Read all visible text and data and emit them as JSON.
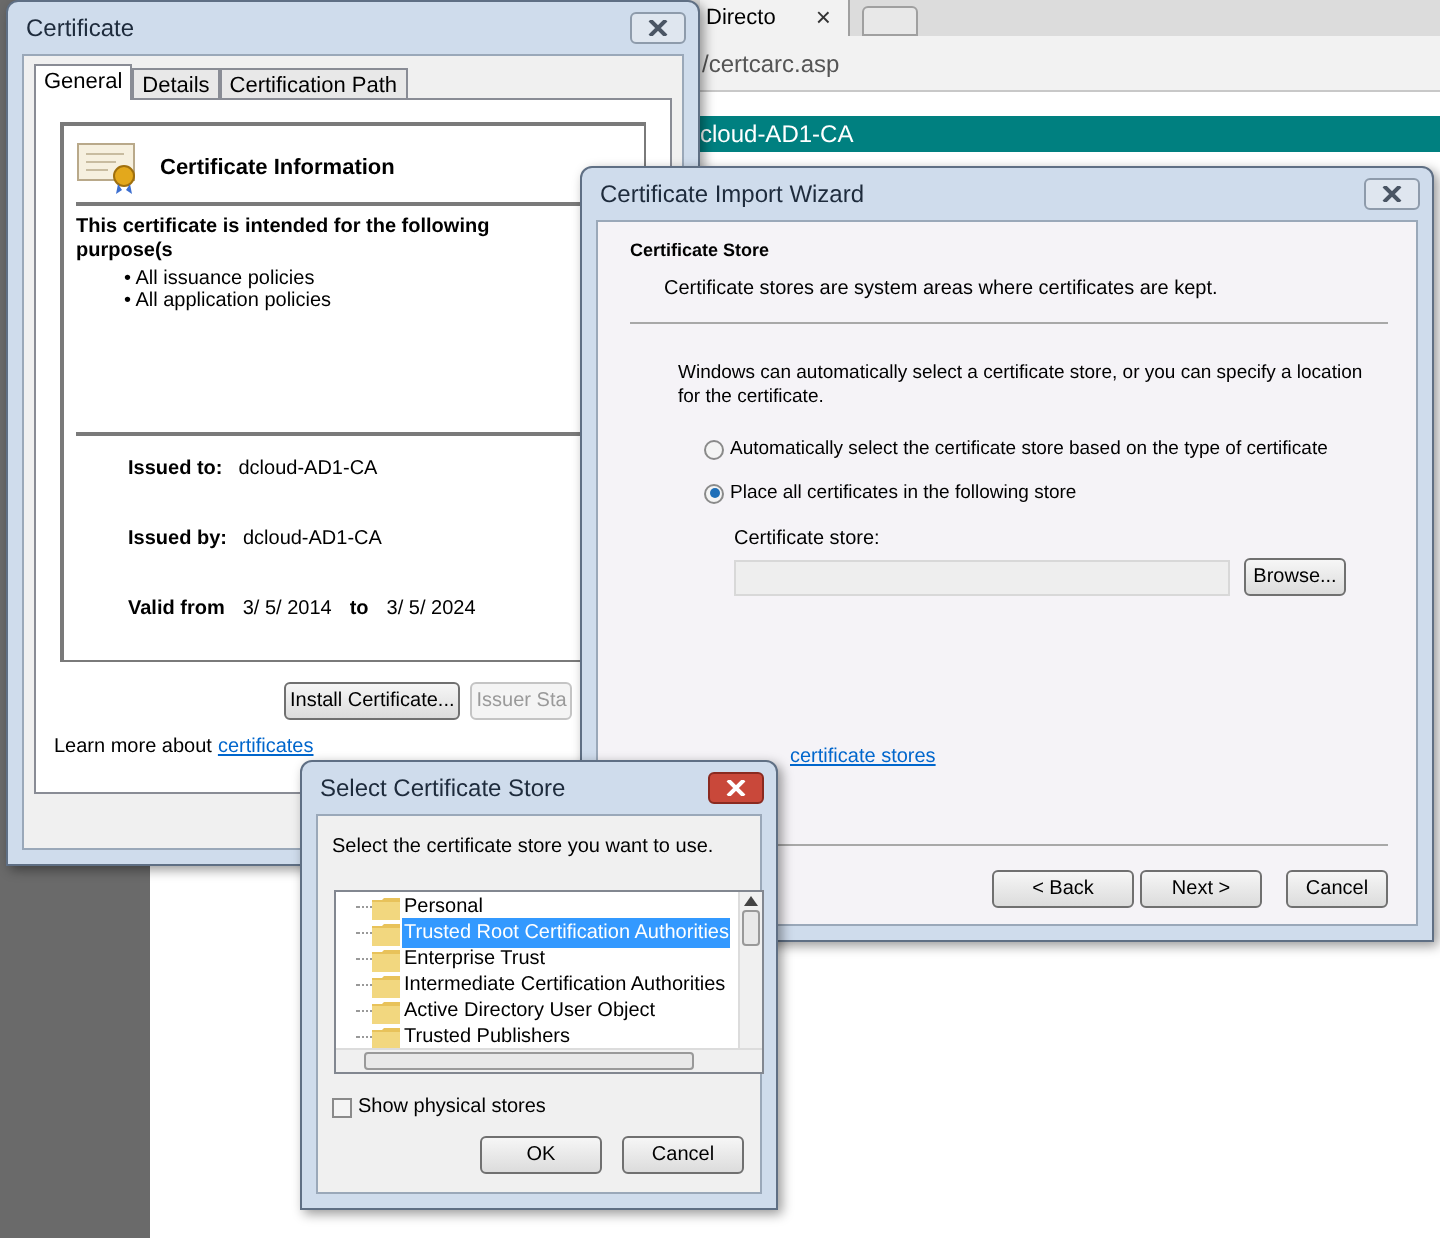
{
  "browser": {
    "tab_title": "Directo",
    "tab_close": "×",
    "address": "/certcarc.asp",
    "banner": "cloud-AD1-CA"
  },
  "certificate_window": {
    "title": "Certificate",
    "tabs": [
      {
        "label": "General",
        "selected": true
      },
      {
        "label": "Details",
        "selected": false
      },
      {
        "label": "Certification Path",
        "selected": false
      }
    ],
    "info_title": "Certificate Information",
    "purpose_heading": "This certificate is intended for the following purpose(s",
    "purposes": [
      "• All issuance policies",
      "• All application policies"
    ],
    "fields": [
      {
        "label": "Issued to:",
        "value": "dcloud-AD1-CA"
      },
      {
        "label": "Issued by:",
        "value": "dcloud-AD1-CA"
      }
    ],
    "validity": {
      "label": "Valid from",
      "from": "3/ 5/ 2014",
      "to_label": "to",
      "to": "3/ 5/ 2024"
    },
    "buttons": [
      {
        "label": "Install Certificate...",
        "disabled": false
      },
      {
        "label": "Issuer Sta",
        "disabled": true
      }
    ],
    "learn_more": {
      "text": "Learn more about",
      "link": "certificates"
    }
  },
  "import_wizard": {
    "title": "Certificate Import Wizard",
    "heading": "Certificate Store",
    "description": "Certificate stores are system areas where certificates are kept.",
    "intro": "Windows can automatically select a certificate store, or you can specify a location for the certificate.",
    "options": [
      {
        "label": "Automatically select the certificate store based on the type of certificate",
        "selected": false
      },
      {
        "label": "Place all certificates in the following store",
        "selected": true
      }
    ],
    "store_label": "Certificate store:",
    "browse": "Browse...",
    "learn_more_link": "certificate stores",
    "buttons": [
      "< Back",
      "Next >",
      "Cancel"
    ]
  },
  "select_store": {
    "title": "Select Certificate Store",
    "prompt": "Select the certificate store you want to use.",
    "stores": [
      {
        "label": "Personal",
        "selected": false
      },
      {
        "label": "Trusted Root Certification Authorities",
        "selected": true
      },
      {
        "label": "Enterprise Trust",
        "selected": false
      },
      {
        "label": "Intermediate Certification Authorities",
        "selected": false
      },
      {
        "label": "Active Directory User Object",
        "selected": false
      },
      {
        "label": "Trusted Publishers",
        "selected": false
      }
    ],
    "show_physical": {
      "label": "Show physical stores",
      "checked": false
    },
    "buttons": [
      "OK",
      "Cancel"
    ]
  }
}
